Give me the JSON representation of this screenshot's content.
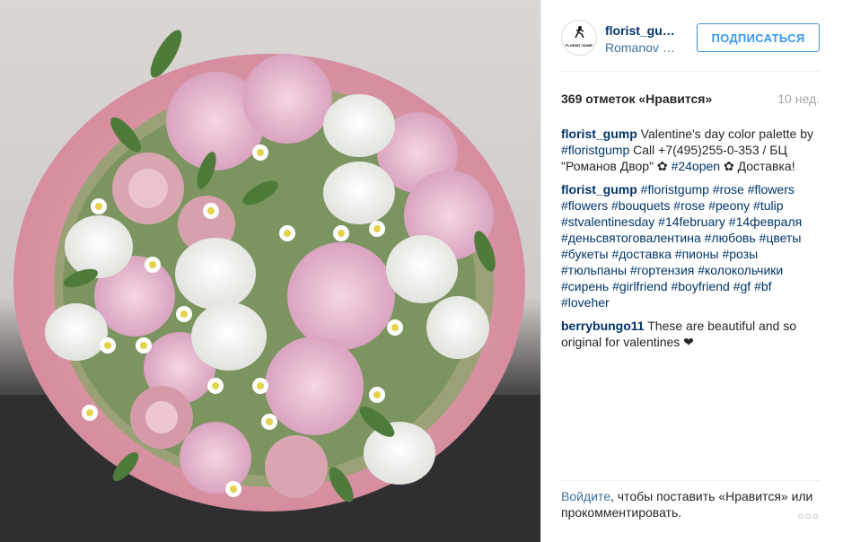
{
  "post": {
    "username": "florist_gump",
    "location": "Romanov Dvor",
    "follow_label": "ПОДПИСАТЬСЯ",
    "avatar_text": "FLORIST GUMP",
    "likes": "369 отметок «Нравится»",
    "time": "10 нед."
  },
  "comments": [
    {
      "user": "florist_gump",
      "line1": " Valentine's day color palette by ",
      "tag1": "#floristgump",
      "line2": " Call +7(495)255-0-353 / БЦ \"Романов Двор\" ✿ ",
      "tag2": "#24open",
      "line3": " ✿ Доставка!"
    },
    {
      "user": "florist_gump",
      "tags": "#floristgump #rose #flowers #flowers #bouquets #rose #peony #tulip #stvalentinesday #14february #14февраля #деньсвятоговалентина #любовь #цветы #букеты #доставка #пионы #розы #тюльпаны #гортензия #колокольчики #сирень #girlfriend #boyfriend #gf #bf #loveher"
    },
    {
      "user": "berrybungo11",
      "text": " These are beautiful and so original for valentines ❤"
    }
  ],
  "footer": {
    "login_link": "Войдите",
    "text": ", чтобы поставить «Нравится» или прокомментировать.",
    "more_label": "○○○"
  },
  "colors": {
    "link_dark": "#003569",
    "link_blue": "#3f729b",
    "button_blue": "#3897f0"
  }
}
